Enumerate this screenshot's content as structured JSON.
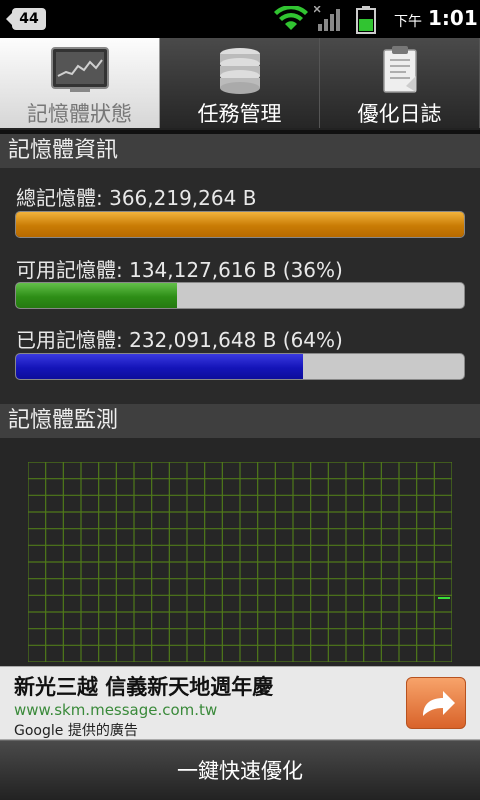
{
  "status_bar": {
    "notification_count": "44",
    "time_prefix": "下午",
    "time": "1:01",
    "icons": [
      "wifi-icon",
      "signal-icon",
      "battery-icon"
    ]
  },
  "tabs": [
    {
      "label": "記憶體狀態",
      "icon": "monitor-chart-icon",
      "active": true
    },
    {
      "label": "任務管理",
      "icon": "database-icon",
      "active": false
    },
    {
      "label": "優化日誌",
      "icon": "clipboard-icon",
      "active": false
    }
  ],
  "memory_info": {
    "header": "記憶體資訊",
    "total_label": "總記憶體: 366,219,264 B",
    "available_label": "可用記憶體: 134,127,616 B (36%)",
    "used_label": "已用記憶體: 232,091,648 B (64%)",
    "total_fraction": 1.0,
    "available_fraction": 0.36,
    "used_fraction": 0.64,
    "colors": {
      "total": "#d08a0e",
      "available": "#2e8e17",
      "used": "#1414b8"
    }
  },
  "memory_monitor": {
    "header": "記憶體監測",
    "grid_color": "#4f7a1a",
    "trace_color": "#3adf3a"
  },
  "ad": {
    "title": "新光三越 信義新天地週年慶",
    "url": "www.skm.message.com.tw",
    "source": "Google 提供的廣告",
    "icon": "share-arrow-icon"
  },
  "actions": {
    "optimize_label": "一鍵快速優化"
  }
}
